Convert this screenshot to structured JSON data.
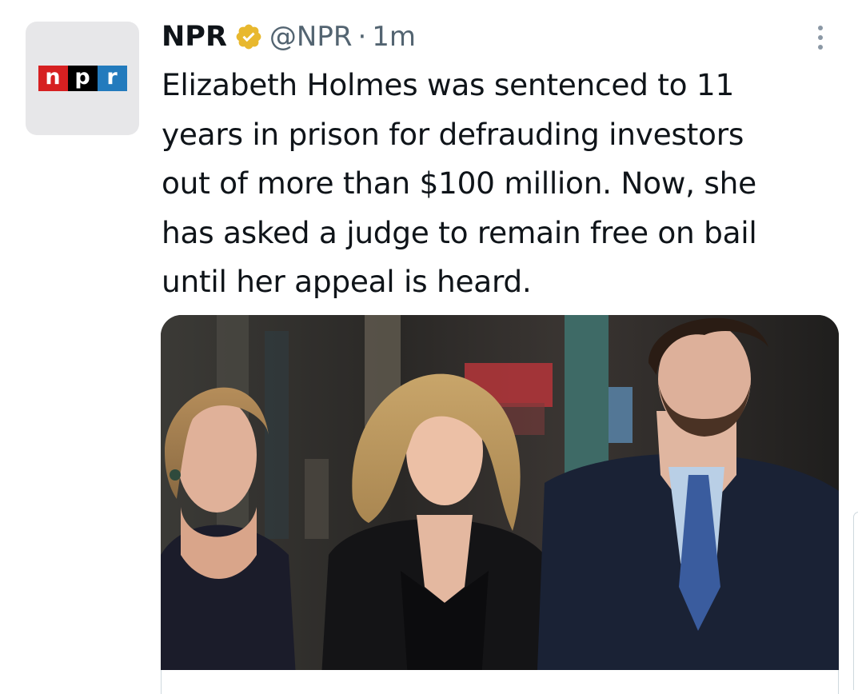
{
  "tweet": {
    "author_name": "NPR",
    "handle": "@NPR",
    "separator": "·",
    "time": "1m",
    "avatar_logo_letters": [
      "n",
      "p",
      "r"
    ],
    "verified_badge_color": "#e8b82e",
    "text_lines": [
      "Elizabeth Holmes was sentenced to 11",
      "years in prison for defrauding investors",
      "out of more than $100 million. Now, she",
      "has asked a judge to remain free on bail",
      "until her appeal is heard."
    ],
    "more_icon": "more-vertical-icon",
    "media": {
      "type": "photo",
      "icon": "news-photo"
    }
  },
  "colors": {
    "text_primary": "#0f1419",
    "text_secondary": "#536471",
    "npr_red": "#d62021",
    "npr_black": "#000000",
    "npr_blue": "#237bbd",
    "border": "#cfd9de"
  }
}
